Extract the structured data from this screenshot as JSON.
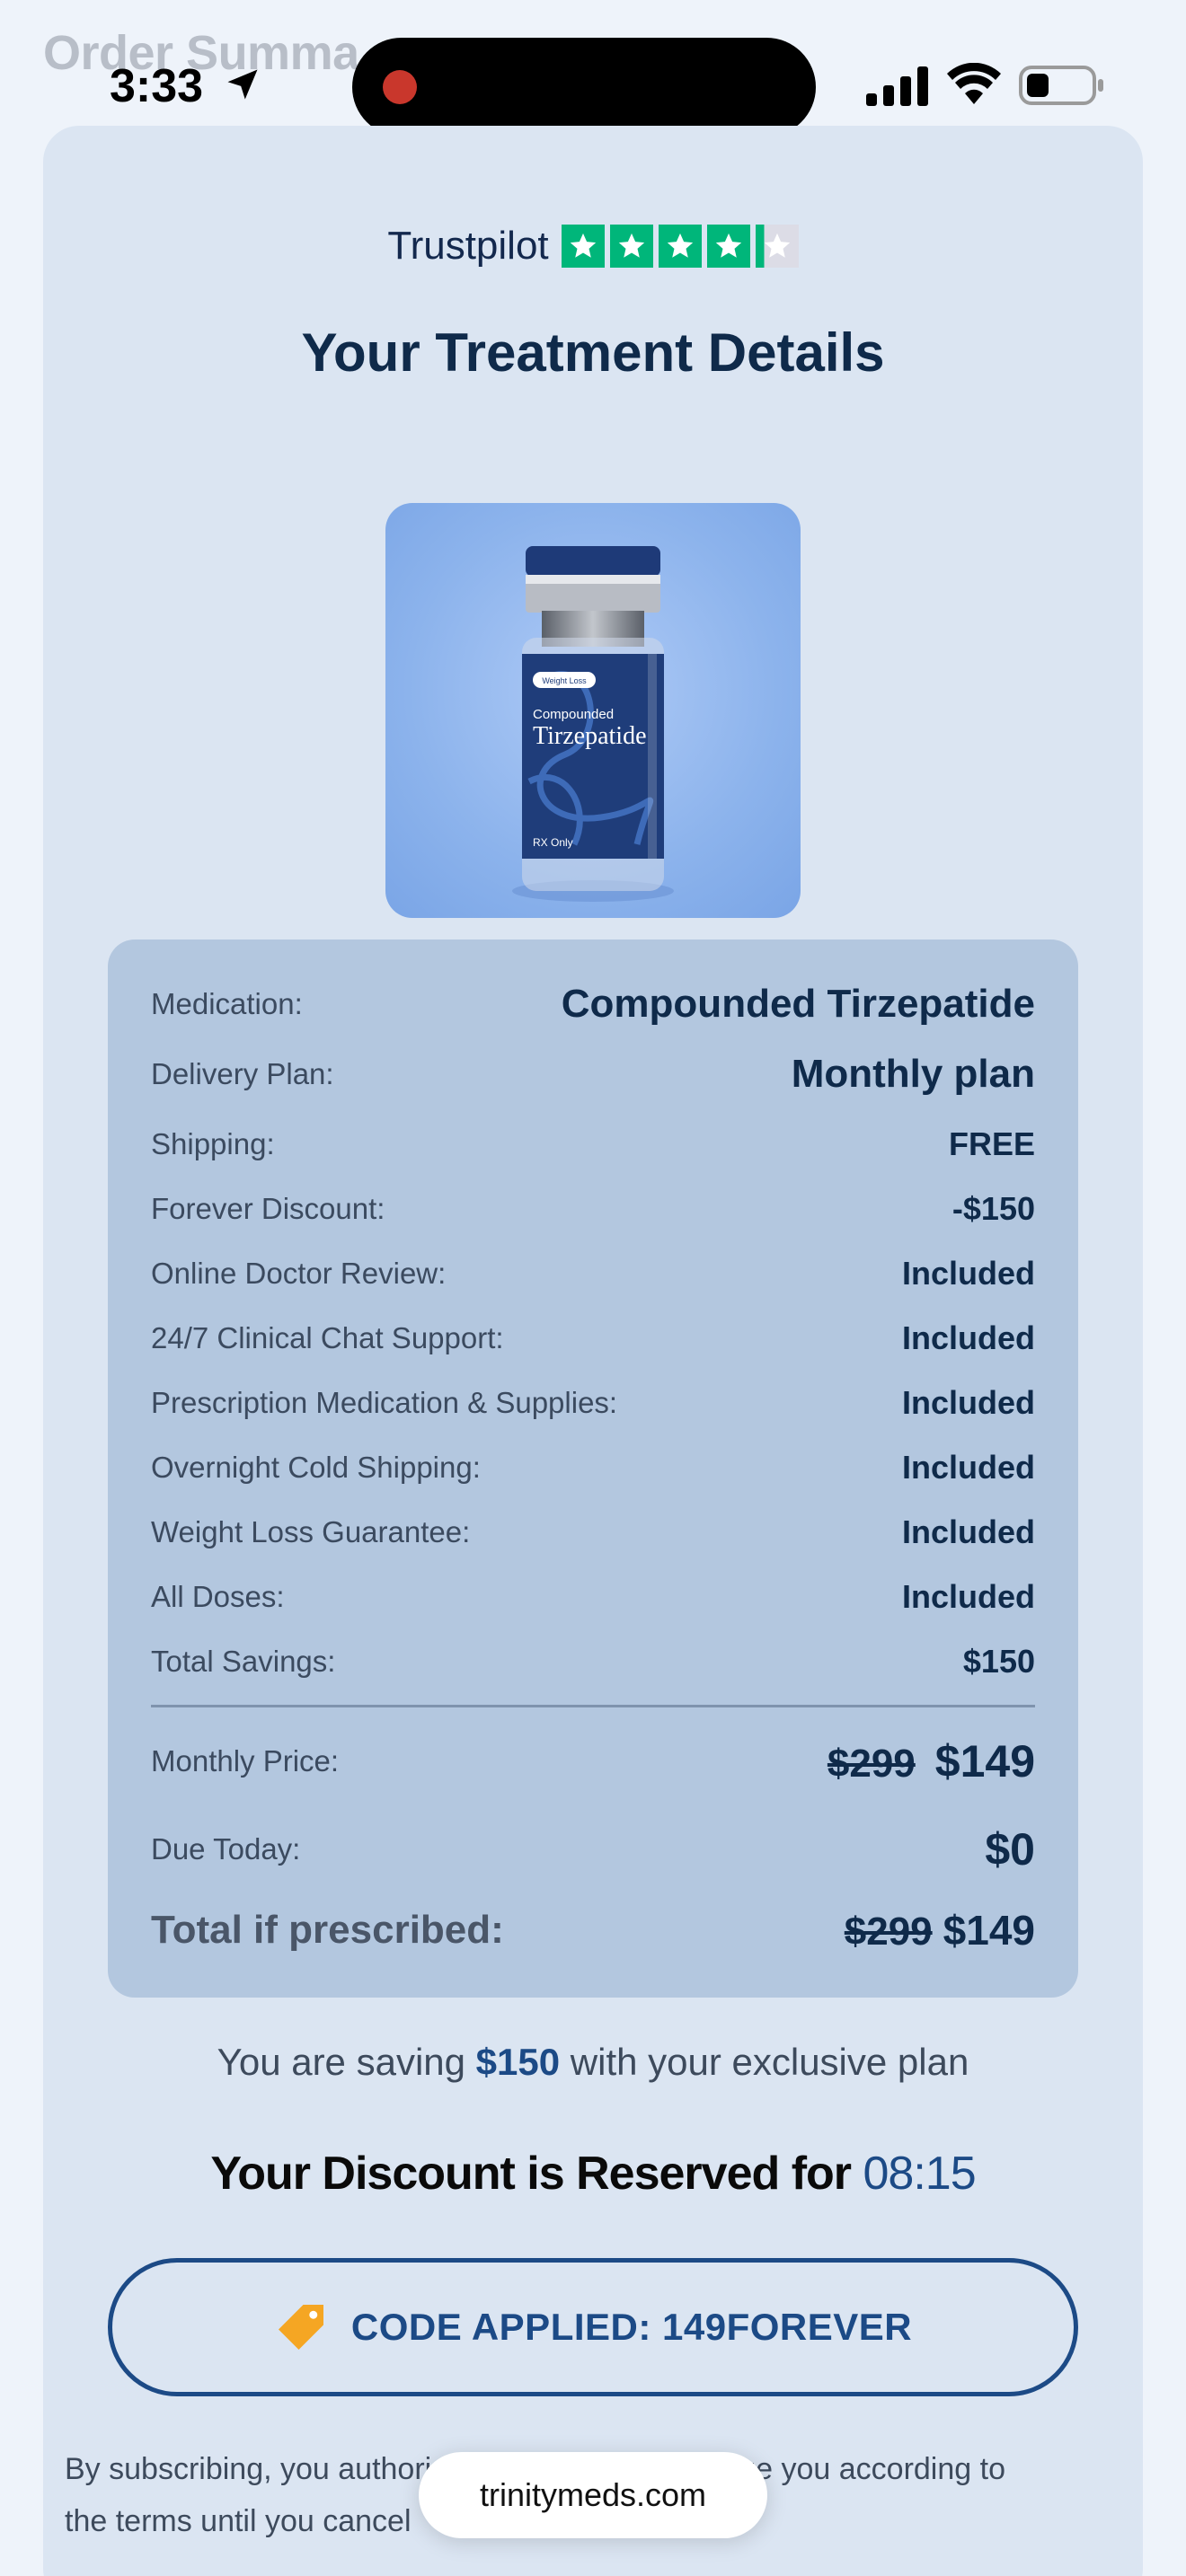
{
  "page_title": "Order Summa",
  "status_bar": {
    "time": "3:33"
  },
  "card": {
    "trustpilot_label": "Trustpilot",
    "heading": "Your Treatment Details",
    "product": {
      "badge": "Weight Loss",
      "line1": "Compounded",
      "line2": "Tirzepatide",
      "footer": "RX Only"
    },
    "details": [
      {
        "label": "Medication:",
        "value": "Compounded Tirzepatide"
      },
      {
        "label": "Delivery Plan:",
        "value": "Monthly plan"
      },
      {
        "label": "Shipping:",
        "value": "FREE"
      },
      {
        "label": "Forever Discount:",
        "value": "-$150"
      },
      {
        "label": "Online Doctor Review:",
        "value": "Included"
      },
      {
        "label": "24/7 Clinical Chat Support:",
        "value": "Included"
      },
      {
        "label": "Prescription Medication & Supplies:",
        "value": "Included"
      },
      {
        "label": "Overnight Cold Shipping:",
        "value": "Included"
      },
      {
        "label": "Weight Loss Guarantee:",
        "value": "Included"
      },
      {
        "label": "All Doses:",
        "value": "Included"
      },
      {
        "label": "Total Savings:",
        "value": "$150"
      }
    ],
    "monthly_price": {
      "label": "Monthly Price:",
      "old": "$299",
      "new": "$149"
    },
    "due_today": {
      "label": "Due Today:",
      "value": "$0"
    },
    "total": {
      "label": "Total if prescribed:",
      "old": "$299",
      "new": "$149"
    },
    "saving_pre": "You are saving ",
    "saving_amount": "$150",
    "saving_post": " with your exclusive plan",
    "reserved_text": "Your Discount is Reserved for ",
    "reserved_timer": "08:15",
    "code_button": "CODE APPLIED: 149FOREVER",
    "disclaimer": "By subscribing, you authorize Trinity Meds to charge you according to the terms until you cancel"
  },
  "url_bar": {
    "domain": "trinitymeds.com"
  },
  "colors": {
    "accent": "#1c4a86",
    "trustpilot_green": "#00b67a",
    "tag": "#f5a623"
  }
}
